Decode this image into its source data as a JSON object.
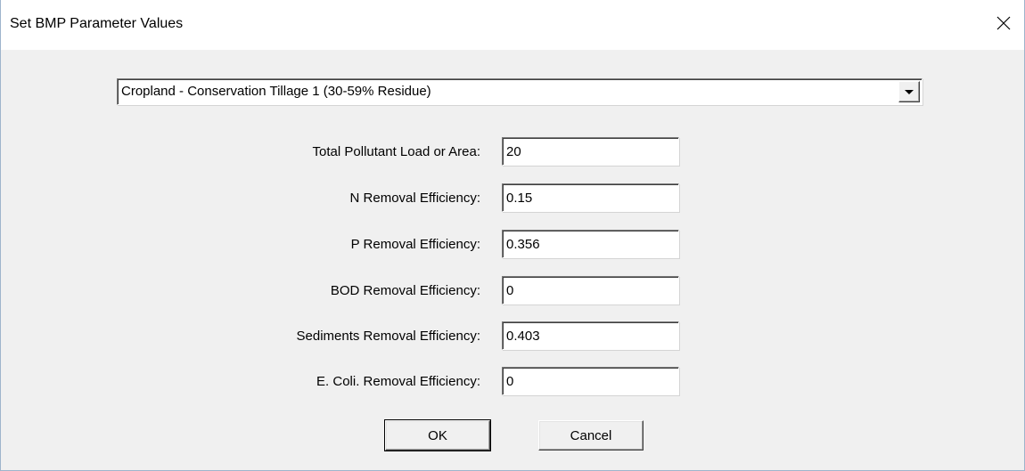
{
  "window": {
    "title": "Set BMP Parameter Values",
    "close_icon": "close-icon"
  },
  "bmp_select": {
    "selected": "Cropland - Conservation Tillage 1 (30-59% Residue)",
    "arrow_icon": "dropdown-arrow-icon"
  },
  "fields": [
    {
      "label": "Total Pollutant Load or Area:",
      "value": "20"
    },
    {
      "label": "N Removal Efficiency:",
      "value": "0.15"
    },
    {
      "label": "P Removal Efficiency:",
      "value": "0.356"
    },
    {
      "label": "BOD Removal Efficiency:",
      "value": "0"
    },
    {
      "label": "Sediments Removal Efficiency:",
      "value": "0.403"
    },
    {
      "label": "E. Coli. Removal Efficiency:",
      "value": "0"
    }
  ],
  "buttons": {
    "ok_label": "OK",
    "cancel_label": "Cancel"
  }
}
